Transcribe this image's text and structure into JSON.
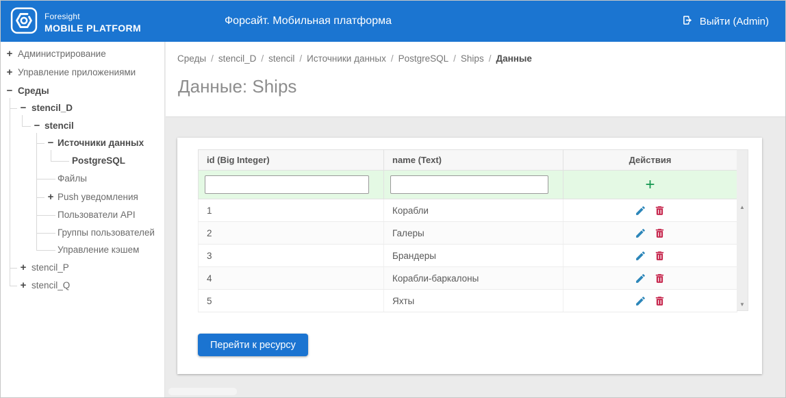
{
  "header": {
    "logo_line1": "Foresight",
    "logo_line2": "MOBILE PLATFORM",
    "title": "Форсайт. Мобильная платформа",
    "logout_label": "Выйти (Admin)"
  },
  "sidebar": {
    "items": [
      {
        "label": "Администрирование",
        "glyph": "+"
      },
      {
        "label": "Управление приложениями",
        "glyph": "+"
      },
      {
        "label": "Среды",
        "glyph": "−"
      },
      {
        "label": "stencil_D",
        "glyph": "−"
      },
      {
        "label": "stencil",
        "glyph": "−"
      },
      {
        "label": "Источники данных",
        "glyph": "−"
      },
      {
        "label": "PostgreSQL",
        "glyph": ""
      },
      {
        "label": "Файлы",
        "glyph": ""
      },
      {
        "label": "Push уведомления",
        "glyph": "+"
      },
      {
        "label": "Пользователи API",
        "glyph": ""
      },
      {
        "label": "Группы пользователей",
        "glyph": ""
      },
      {
        "label": "Управление кэшем",
        "glyph": ""
      },
      {
        "label": "stencil_P",
        "glyph": "+"
      },
      {
        "label": "stencil_Q",
        "glyph": "+"
      }
    ]
  },
  "breadcrumb": {
    "separator": "/",
    "items": [
      "Среды",
      "stencil_D",
      "stencil",
      "Источники данных",
      "PostgreSQL",
      "Ships",
      "Данные"
    ]
  },
  "page": {
    "title": "Данные: Ships"
  },
  "table": {
    "columns": [
      "id (Big Integer)",
      "name (Text)",
      "Действия"
    ],
    "filters": {
      "id_value": "",
      "name_value": ""
    },
    "add_glyph": "+",
    "rows": [
      {
        "id": "1",
        "name": "Корабли"
      },
      {
        "id": "2",
        "name": "Галеры"
      },
      {
        "id": "3",
        "name": "Брандеры"
      },
      {
        "id": "4",
        "name": "Корабли-баркалоны"
      },
      {
        "id": "5",
        "name": "Яхты"
      }
    ]
  },
  "buttons": {
    "go_to_resource": "Перейти к ресурсу"
  },
  "icons": {
    "scroll_up": "▲",
    "scroll_down": "▼"
  },
  "colors": {
    "header_blue": "#1b75d1",
    "filter_green": "#e4f9e4",
    "add_green": "#13964f",
    "edit_blue": "#2c86b9",
    "delete_red": "#c5234a",
    "button_blue": "#1b74d1"
  }
}
